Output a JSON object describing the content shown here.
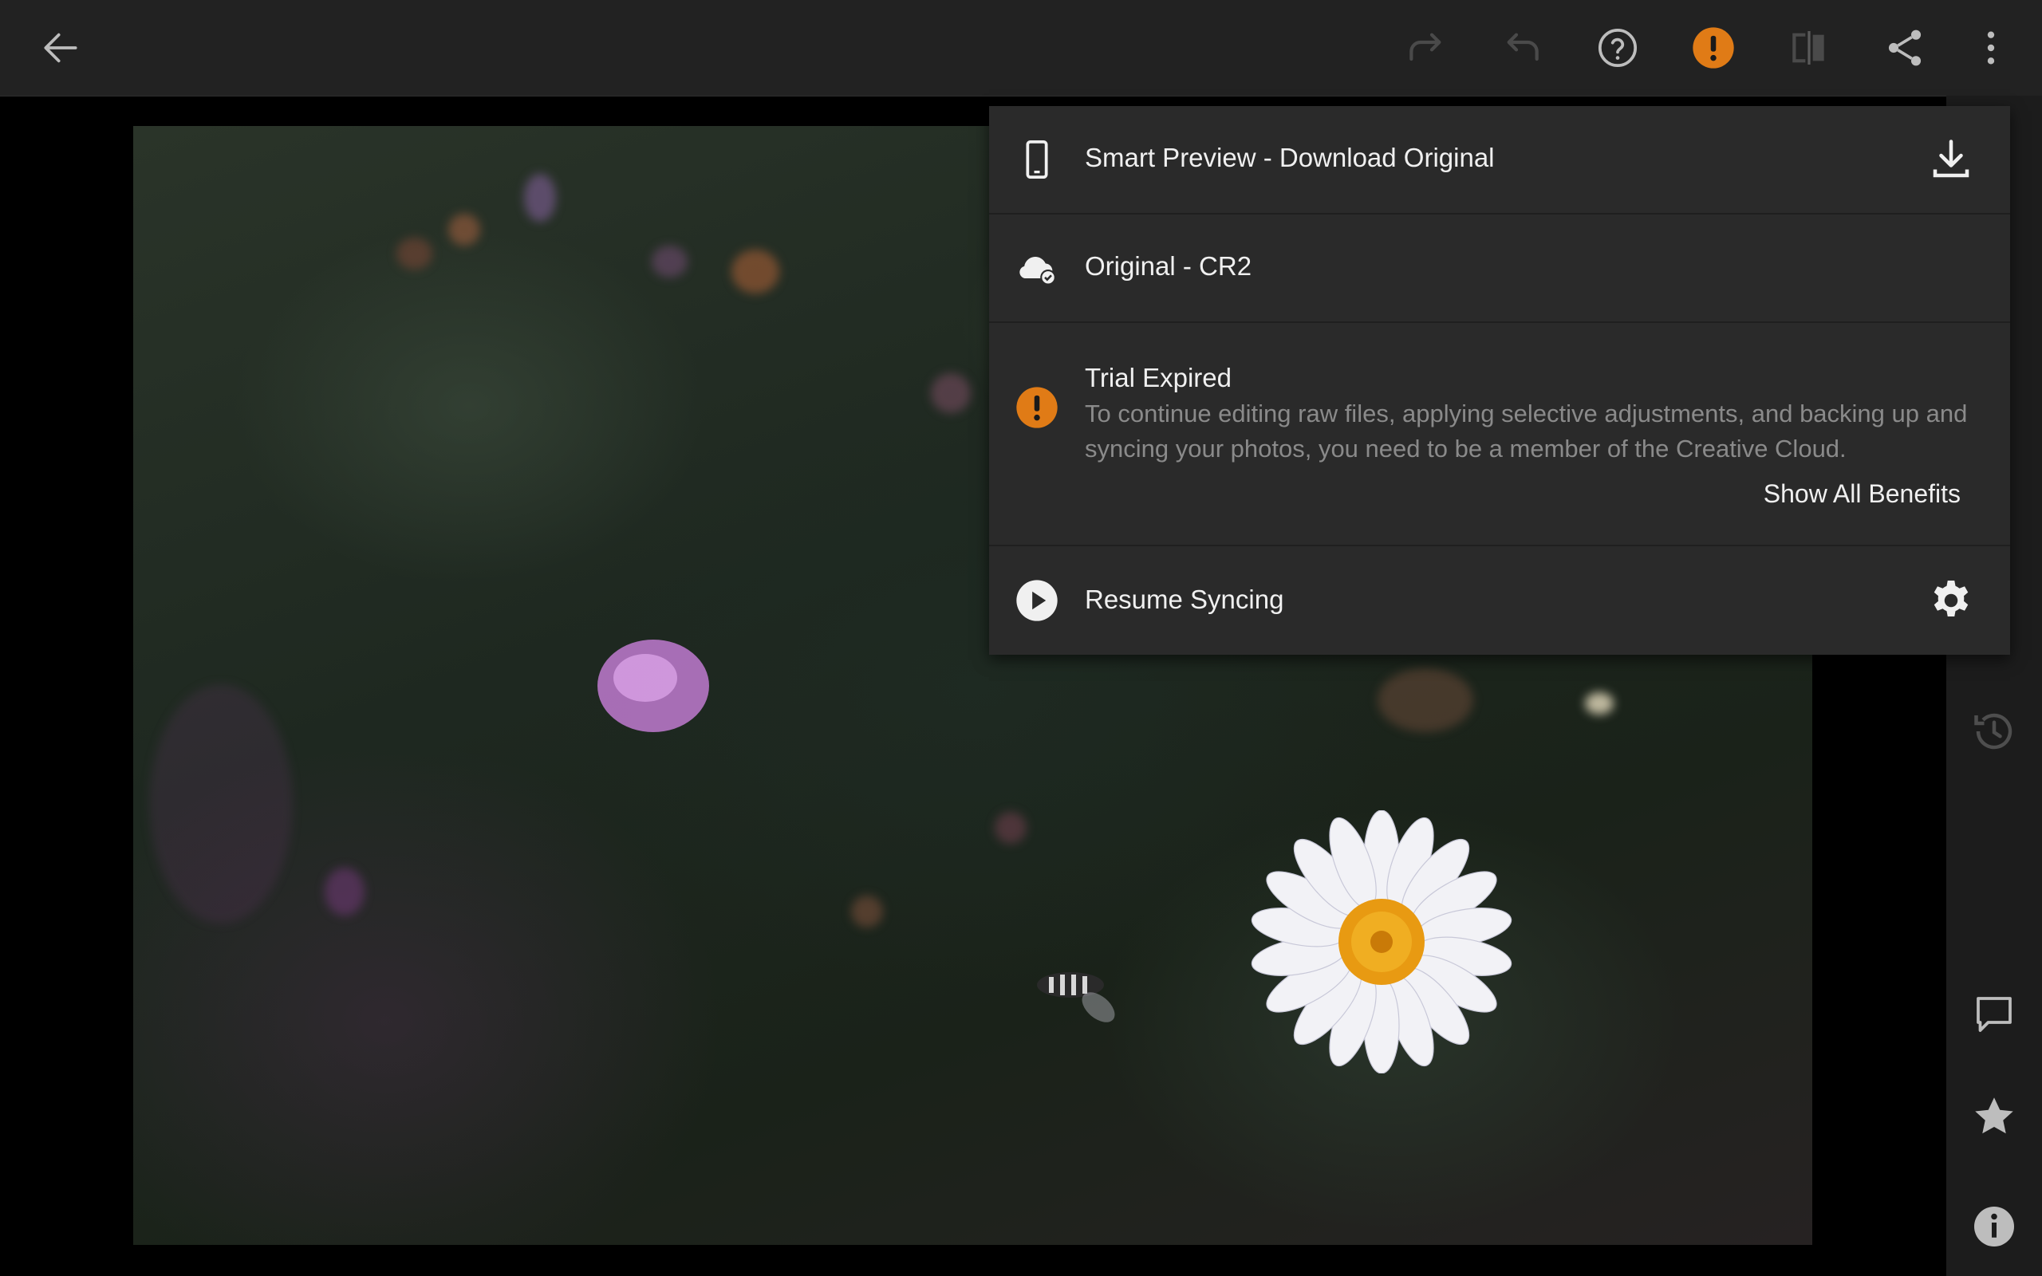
{
  "toolbar": {
    "icons": [
      "back-arrow-icon",
      "redo-icon",
      "undo-icon",
      "help-icon",
      "alert-icon",
      "compare-icon",
      "share-icon",
      "more-vertical-icon"
    ]
  },
  "colors": {
    "background": "#000000",
    "toolbar": "#222222",
    "panel": "#2a2a2a",
    "accent_orange": "#e07b16",
    "text_primary": "#f0f0f0",
    "text_secondary": "#8a8a8a"
  },
  "menu": {
    "smart_preview": {
      "label": "Smart Preview - Download Original",
      "icon": "phone-icon",
      "action_icon": "download-icon"
    },
    "original": {
      "label": "Original - CR2",
      "icon": "cloud-check-icon"
    },
    "trial": {
      "title": "Trial Expired",
      "body": "To continue editing raw files, applying selective adjustments, and backing up and syncing your photos, you need to be a member of the Creative Cloud.",
      "link": "Show All Benefits",
      "icon": "alert-icon"
    },
    "resume": {
      "label": "Resume Syncing",
      "icon": "play-icon",
      "action_icon": "gear-icon"
    }
  },
  "sidebar": {
    "icons": [
      "history-icon",
      "comment-icon",
      "star-icon",
      "info-icon"
    ]
  }
}
